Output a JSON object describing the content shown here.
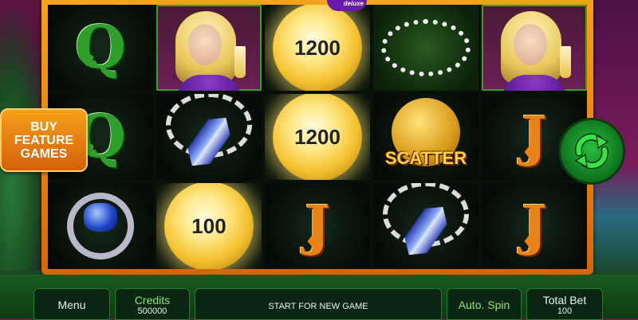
{
  "game": {
    "logo_text": "deluxe",
    "buy_feature_label": "BUY FEATURE GAMES",
    "spin_icon": "refresh-arrows-icon"
  },
  "reels": [
    [
      {
        "type": "letter",
        "letter": "Q",
        "suit": "♣"
      },
      {
        "type": "letter",
        "letter": "Q",
        "suit": "♣"
      },
      {
        "type": "ring"
      }
    ],
    [
      {
        "type": "lady"
      },
      {
        "type": "pendant"
      },
      {
        "type": "coin",
        "value": "100"
      }
    ],
    [
      {
        "type": "coin",
        "value": "1200"
      },
      {
        "type": "coin",
        "value": "1200"
      },
      {
        "type": "letter",
        "letter": "J",
        "suit": "♦"
      }
    ],
    [
      {
        "type": "necklace"
      },
      {
        "type": "scatter",
        "label": "SCATTER"
      },
      {
        "type": "pendant"
      }
    ],
    [
      {
        "type": "lady"
      },
      {
        "type": "letter",
        "letter": "J",
        "suit": "♦"
      },
      {
        "type": "letter",
        "letter": "J",
        "suit": "♦"
      }
    ]
  ],
  "bottom_bar": {
    "menu_label": "Menu",
    "credits_label": "Credits",
    "credits_value": "500000",
    "status_text": "START FOR NEW GAME",
    "autospin_label": "Auto. Spin",
    "total_bet_label": "Total Bet",
    "total_bet_value": "100"
  },
  "colors": {
    "frame": "#f7a21c",
    "accent_green": "#28c040",
    "letter_q": "#2f9e2a",
    "letter_j": "#e8831a"
  }
}
